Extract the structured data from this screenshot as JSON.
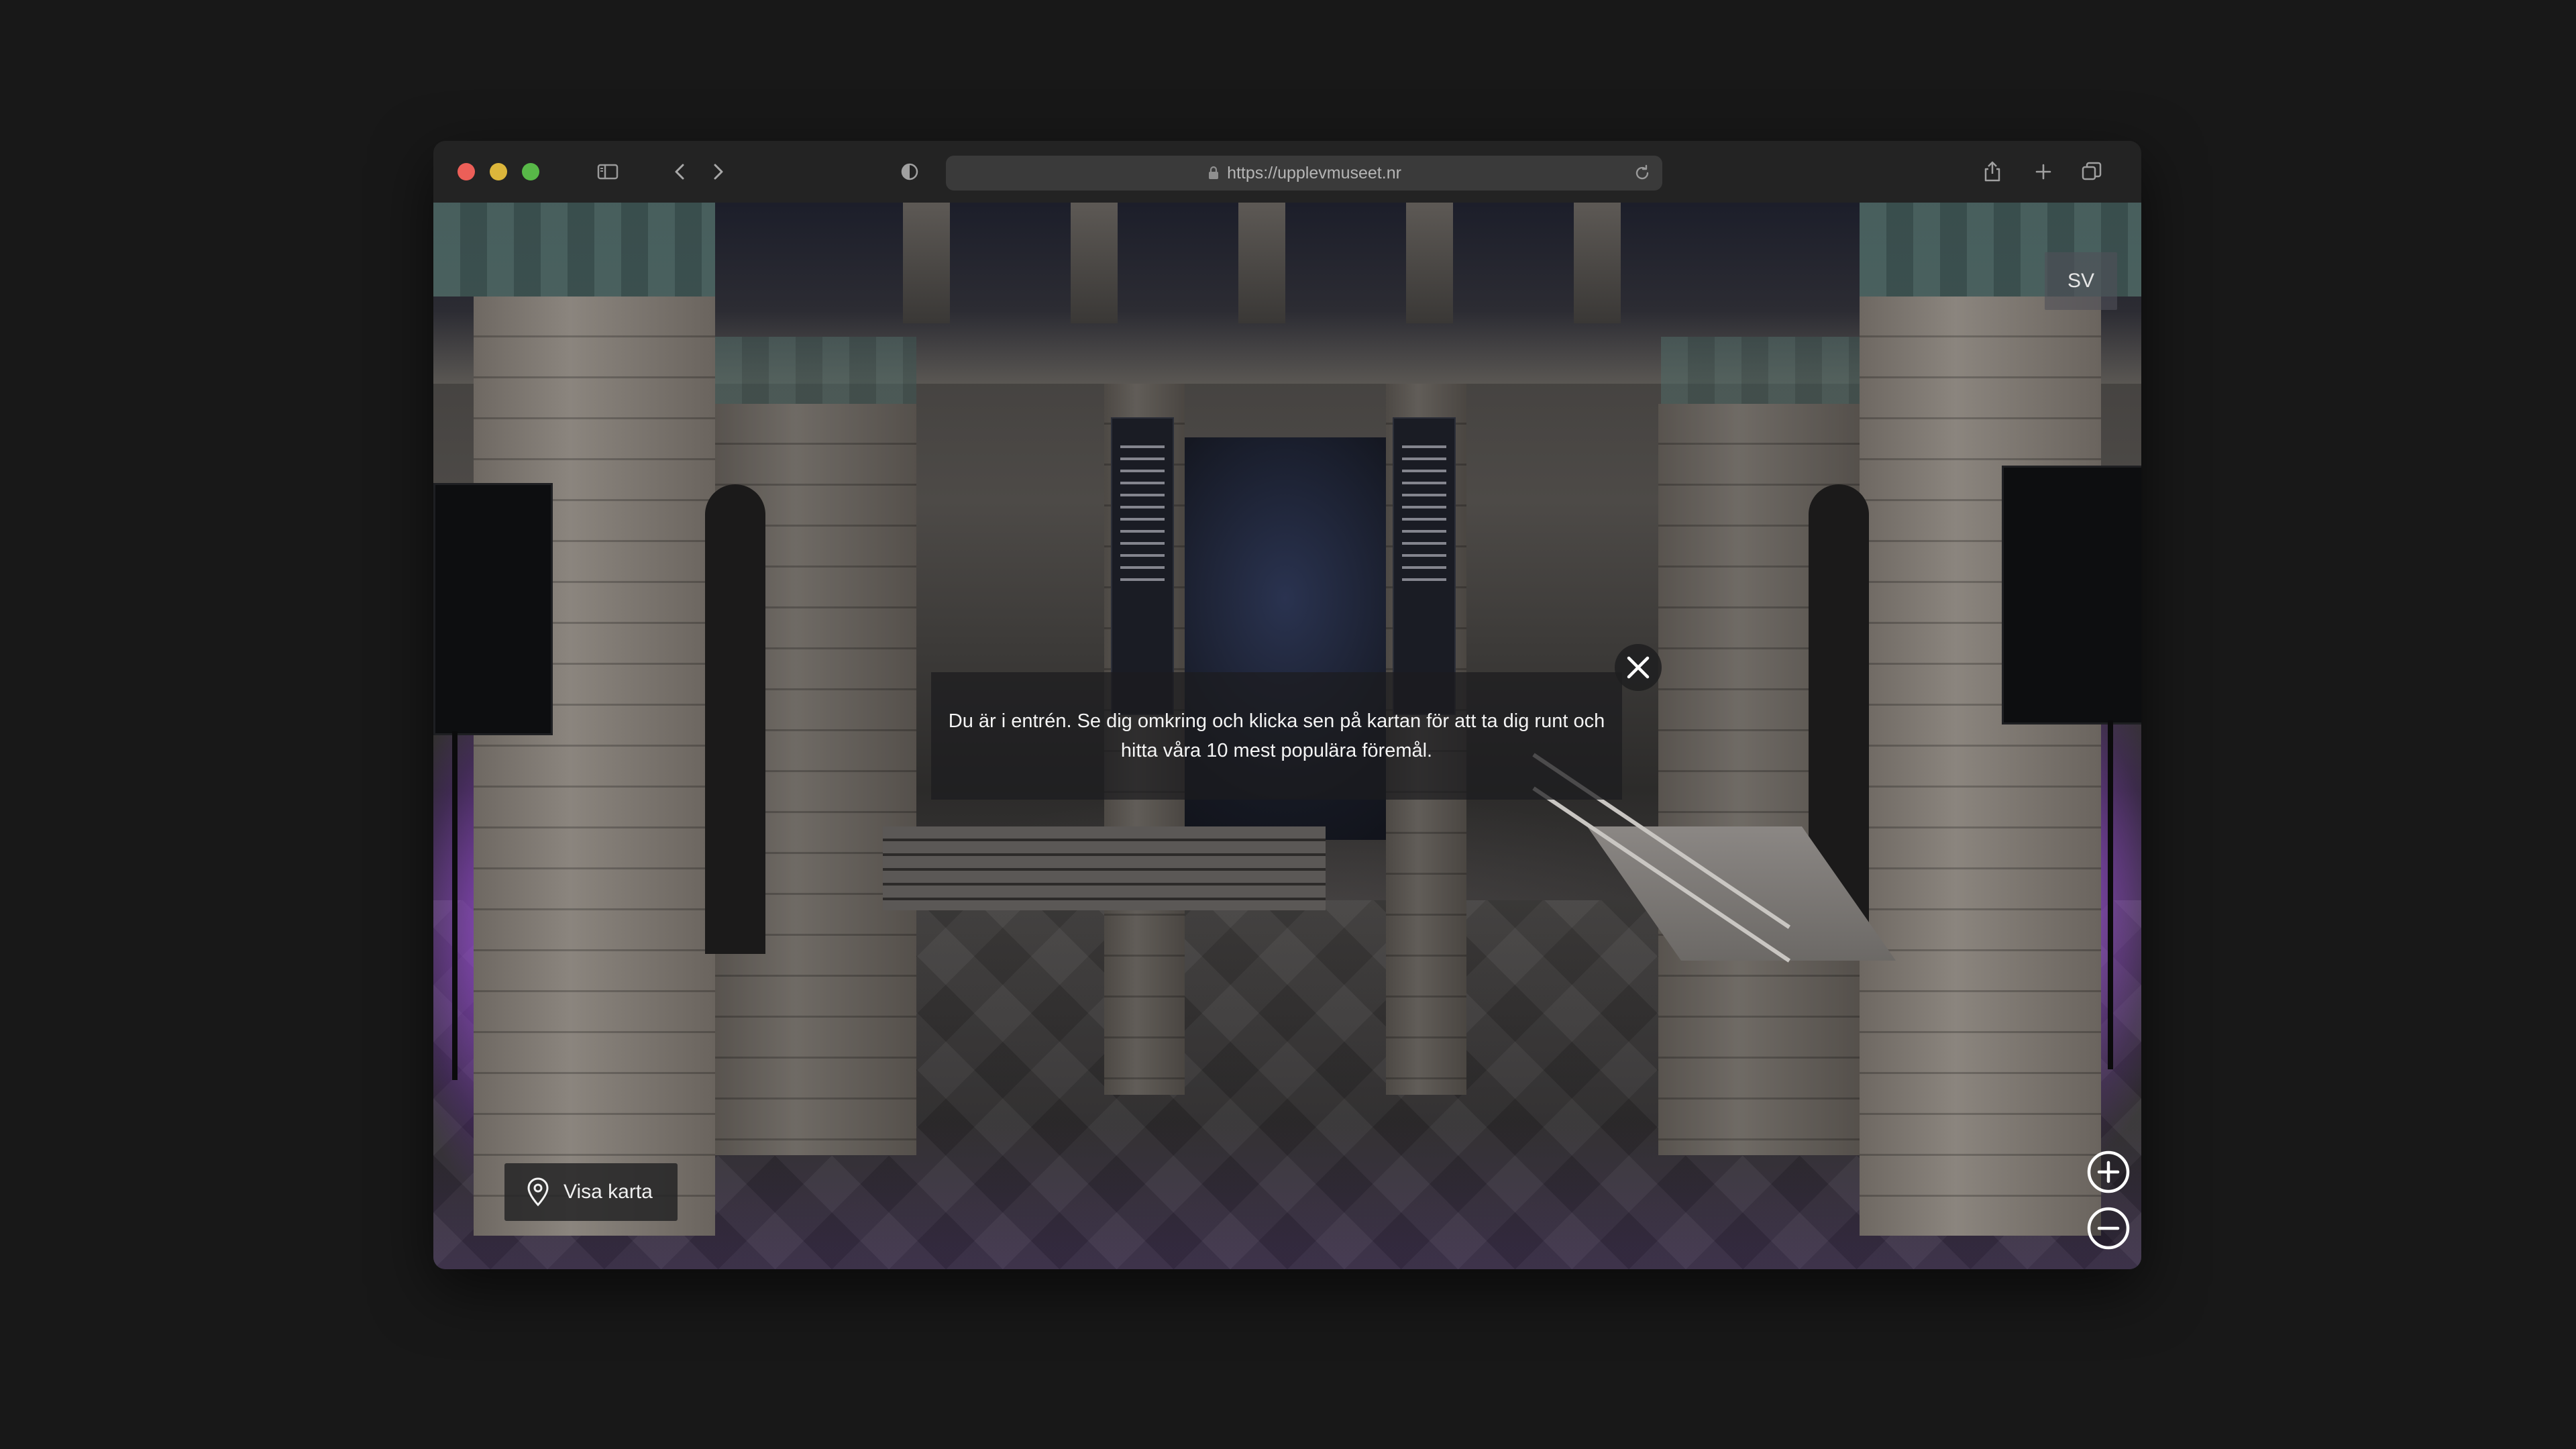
{
  "browser": {
    "url": "https://upplevmuseet.nr",
    "traffic_lights": {
      "close": "#ec5f58",
      "minimize": "#dcb63b",
      "maximize": "#58b848"
    },
    "icons": [
      "sidebar-icon",
      "back-icon",
      "forward-icon",
      "privacy-shield-icon",
      "lock-icon",
      "reload-icon",
      "share-icon",
      "new-tab-icon",
      "tab-overview-icon"
    ]
  },
  "tour": {
    "language": "SV",
    "info_text": "Du är i entrén. Se dig omkring och klicka sen på kartan för att ta dig runt och hitta våra 10 mest populära föremål.",
    "map_button_label": "Visa karta",
    "accent_purple": "#a64dff"
  }
}
